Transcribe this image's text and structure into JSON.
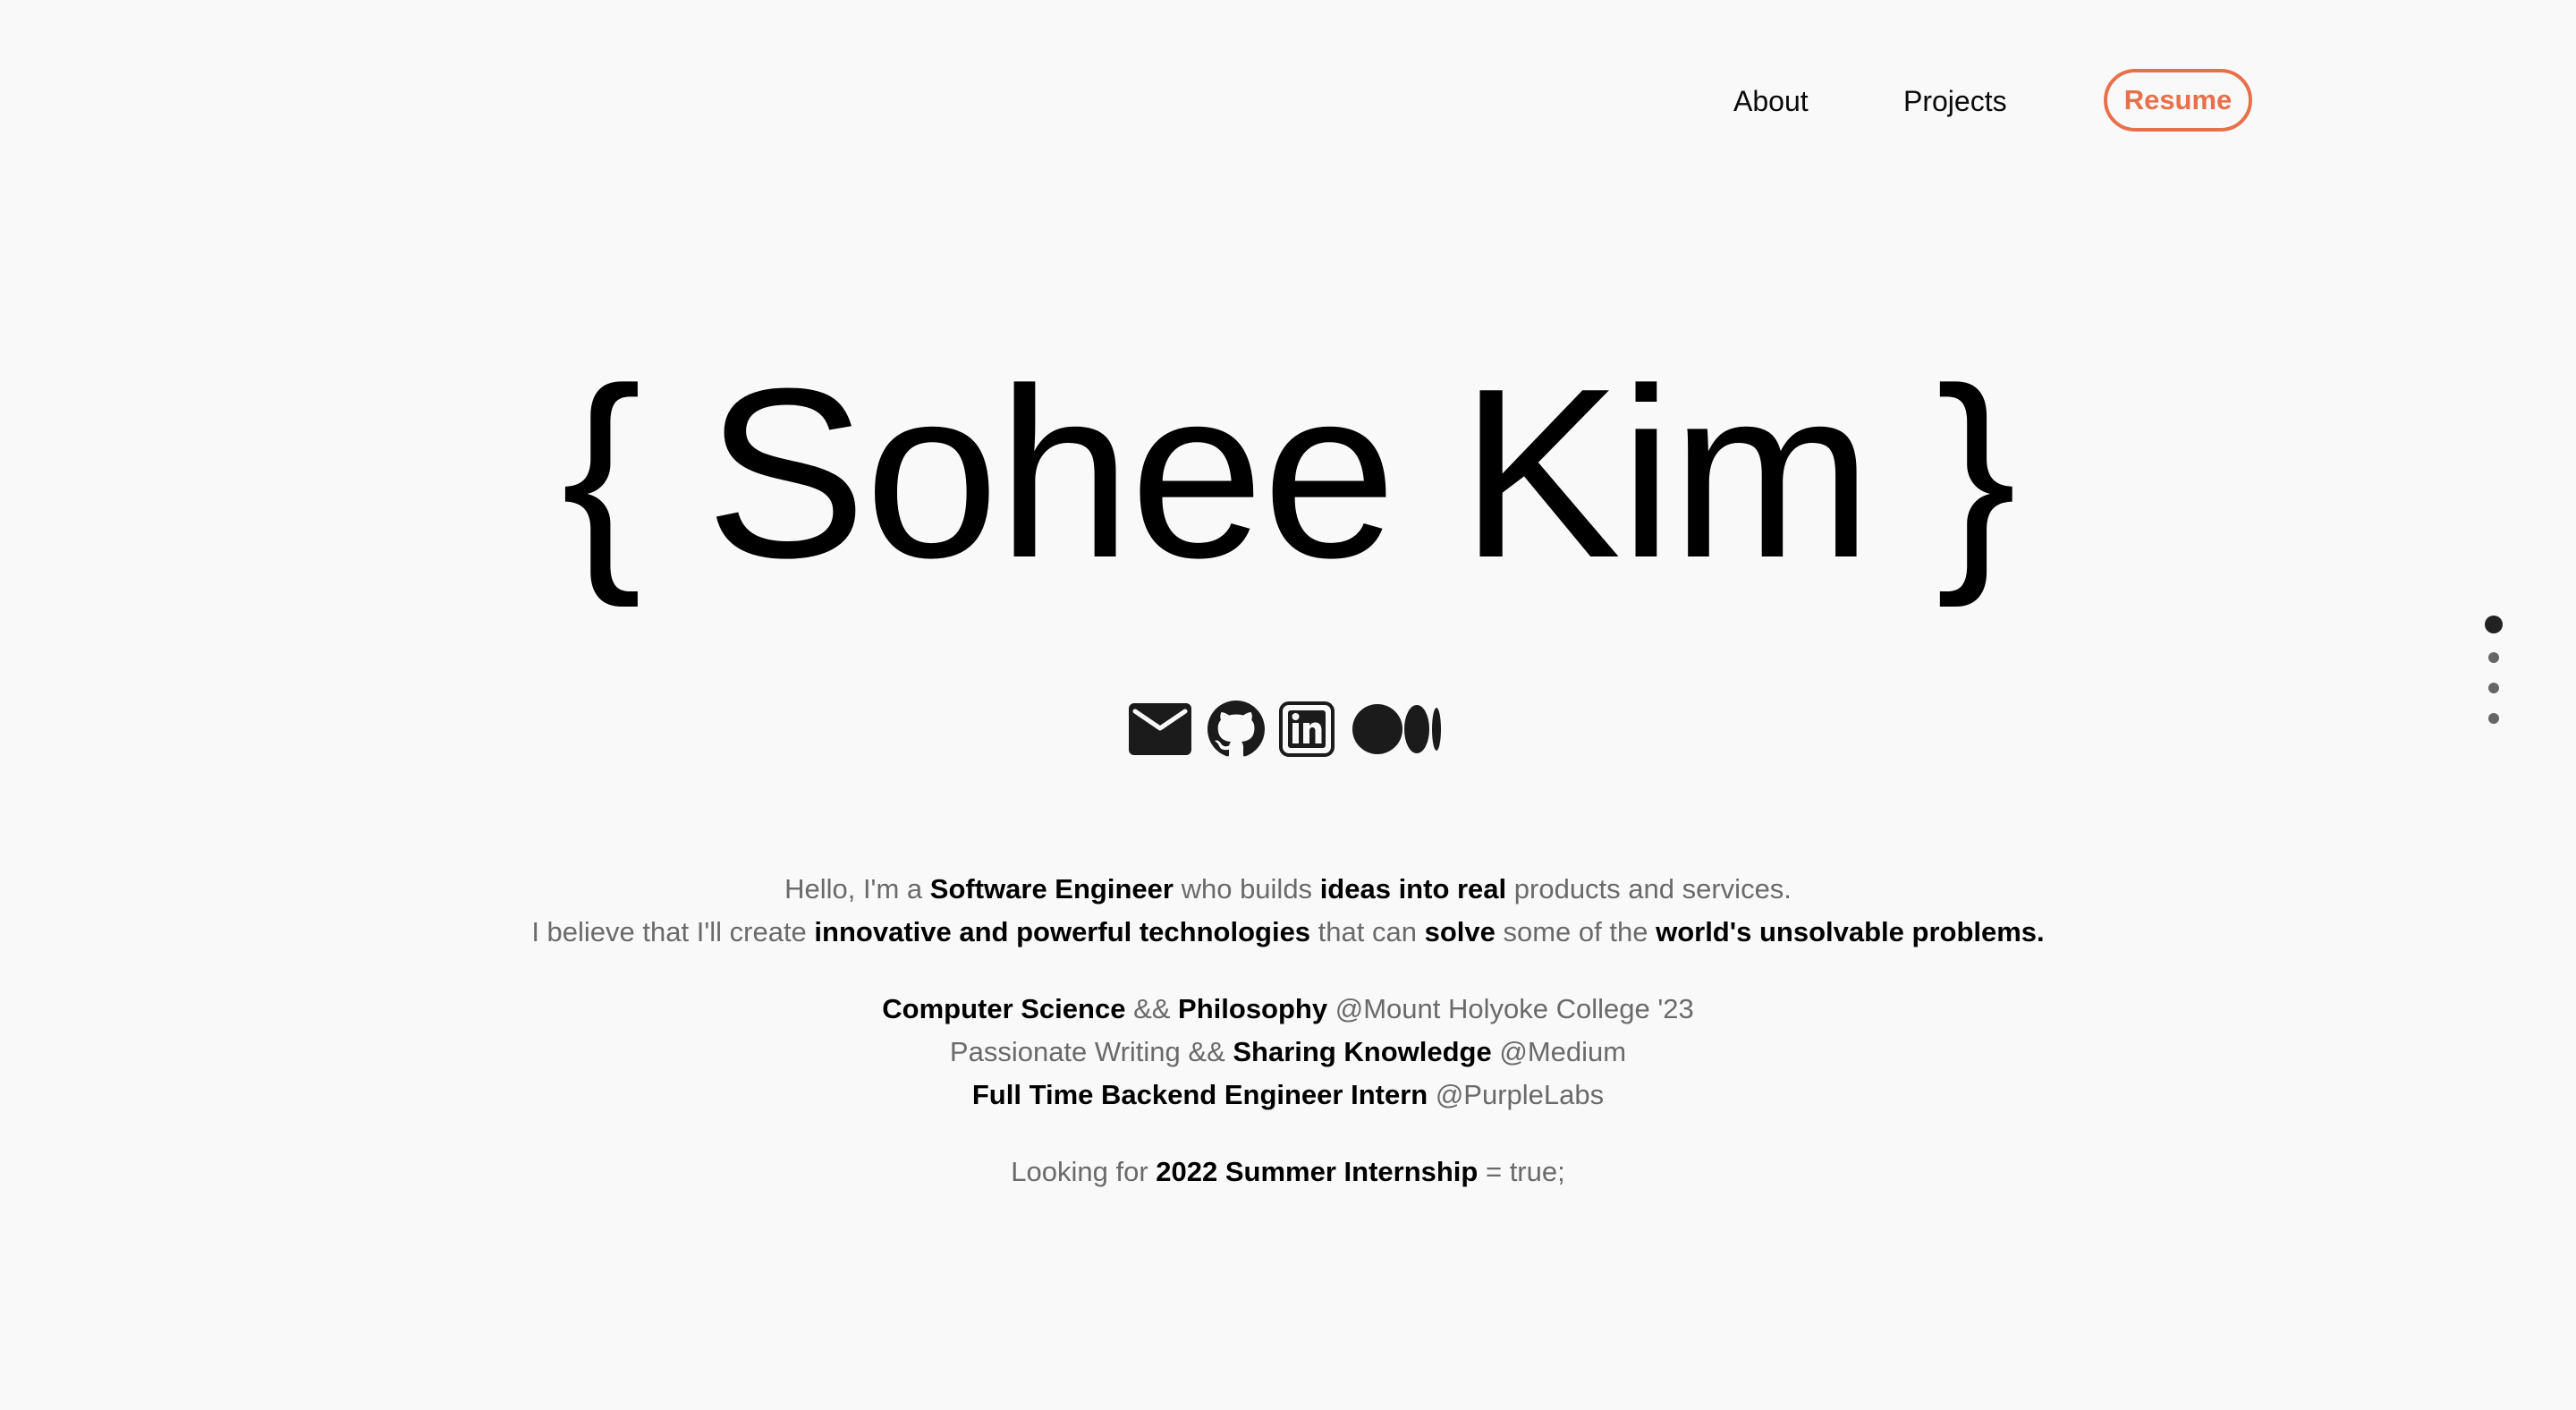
{
  "nav": {
    "about": "About",
    "projects": "Projects",
    "resume": "Resume",
    "accent_color": "#e8704a"
  },
  "hero": {
    "title": "{ Sohee Kim }"
  },
  "socials": [
    {
      "icon": "mail-icon"
    },
    {
      "icon": "github-icon"
    },
    {
      "icon": "linkedin-icon"
    },
    {
      "icon": "medium-icon"
    }
  ],
  "intro": {
    "line1": {
      "p1": "Hello, I'm a ",
      "b1": "Software Engineer",
      "p2": " who builds ",
      "b2": "ideas into real",
      "p3": " products and services."
    },
    "line2": {
      "p1": "I believe that I'll create ",
      "b1": "innovative and powerful technologies",
      "p2": " that can ",
      "b2": "solve",
      "p3": " some of the ",
      "b3": "world's unsolvable problems."
    }
  },
  "background": {
    "line1": {
      "b1": "Computer Science",
      "p1": " && ",
      "b2": "Philosophy",
      "p2": " @Mount Holyoke College '23"
    },
    "line2": {
      "p1": "Passionate Writing && ",
      "b1": "Sharing Knowledge",
      "p2": " @Medium"
    },
    "line3": {
      "b1": "Full Time Backend Engineer Intern",
      "p1": " @PurpleLabs"
    }
  },
  "looking": {
    "p1": "Looking for ",
    "b1": "2022 Summer Internship",
    "p2": " = true;"
  },
  "section_dots": {
    "count": 4,
    "active_index": 0
  }
}
